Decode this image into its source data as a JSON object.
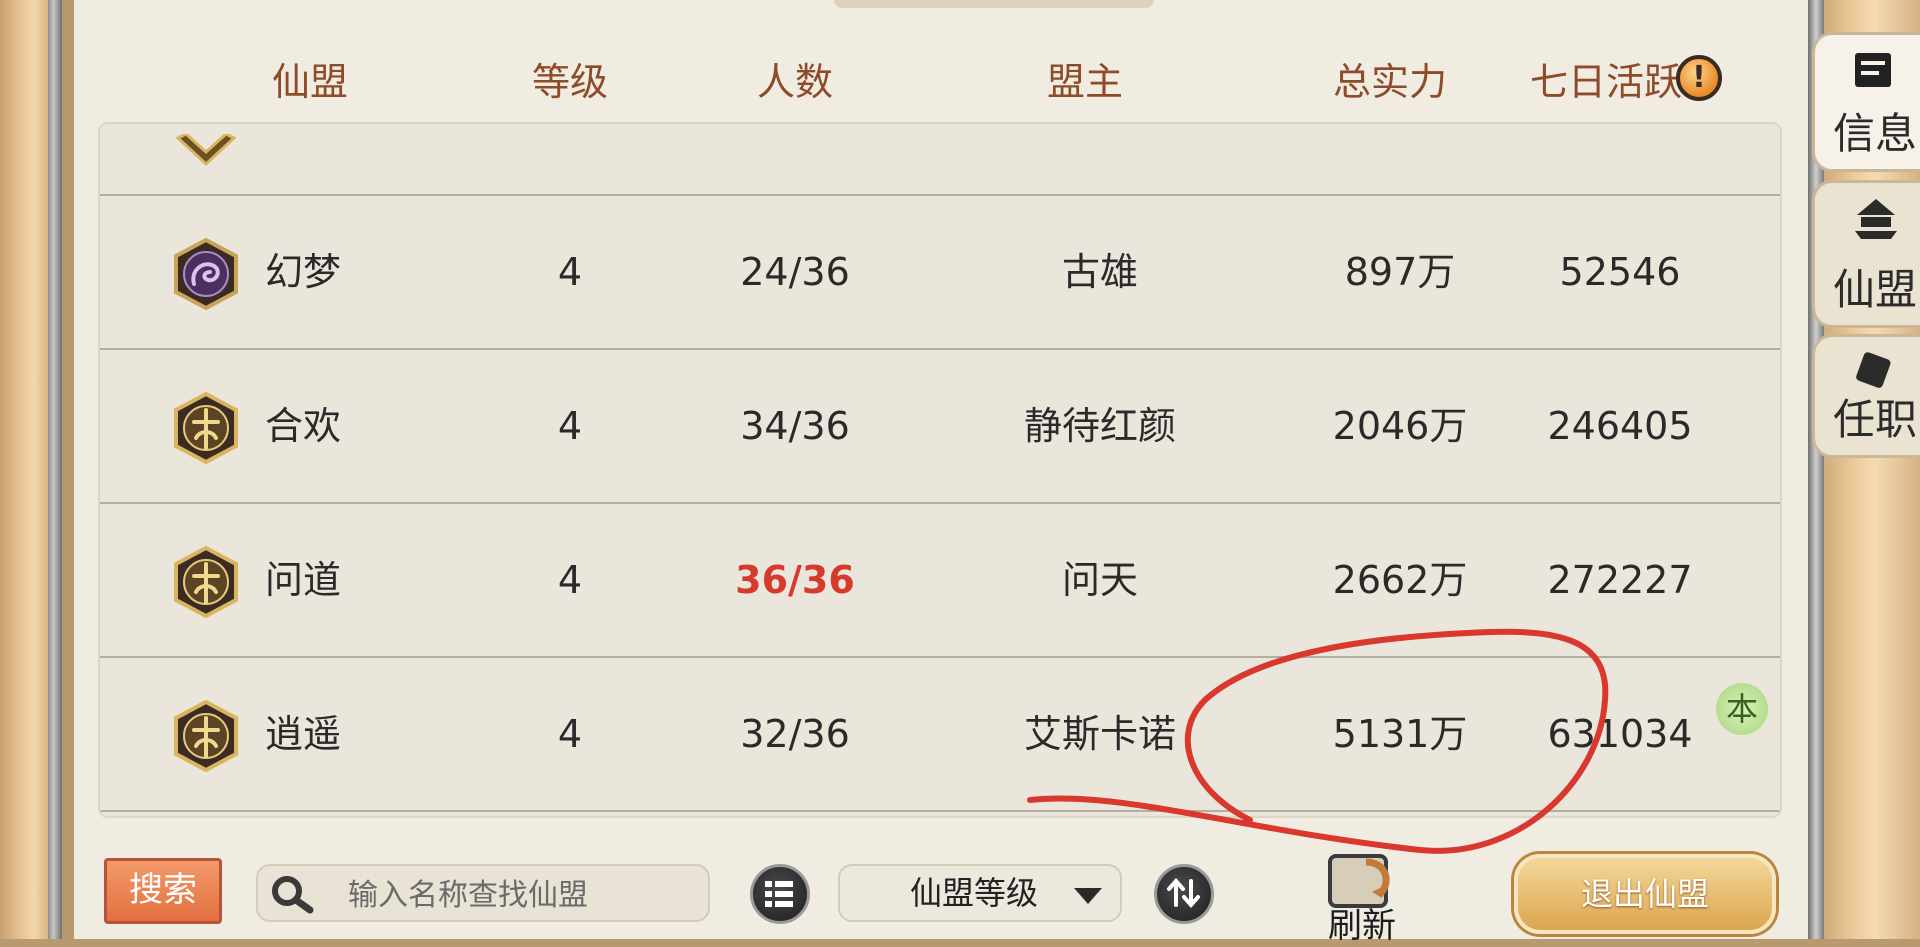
{
  "columns": {
    "alliance": "仙盟",
    "level": "等级",
    "members": "人数",
    "leader": "盟主",
    "power": "总实力",
    "activity": "七日活跃"
  },
  "warn_symbol": "!",
  "rows": [
    {
      "name": "幻梦",
      "level": "4",
      "members": "24/36",
      "leader": "古雄",
      "power": "897万",
      "activity": "52546",
      "emblem": "purple-dragon-emblem",
      "full": false
    },
    {
      "name": "合欢",
      "level": "4",
      "members": "34/36",
      "leader": "静待红颜",
      "power": "2046万",
      "activity": "246405",
      "emblem": "gold-emblem",
      "full": false
    },
    {
      "name": "问道",
      "level": "4",
      "members": "36/36",
      "leader": "问天",
      "power": "2662万",
      "activity": "272227",
      "emblem": "gold-emblem",
      "full": true
    },
    {
      "name": "逍遥",
      "level": "4",
      "members": "32/36",
      "leader": "艾斯卡诺",
      "power": "5131万",
      "activity": "631034",
      "emblem": "gold-emblem",
      "full": false
    }
  ],
  "own_badge": "本",
  "side_tabs": [
    {
      "label": "信息",
      "icon": "scroll-icon"
    },
    {
      "label": "仙盟",
      "icon": "pagoda-icon"
    },
    {
      "label": "任职",
      "icon": "document-icon"
    }
  ],
  "bottom": {
    "search_button": "搜索",
    "search_placeholder": "输入名称查找仙盟",
    "sort_option": "仙盟等级",
    "refresh_label": "刷新",
    "exit_button": "退出仙盟"
  },
  "colors": {
    "header_text": "#8e4b2a",
    "full_members": "#d63a2a",
    "annotation": "#d9382f"
  }
}
